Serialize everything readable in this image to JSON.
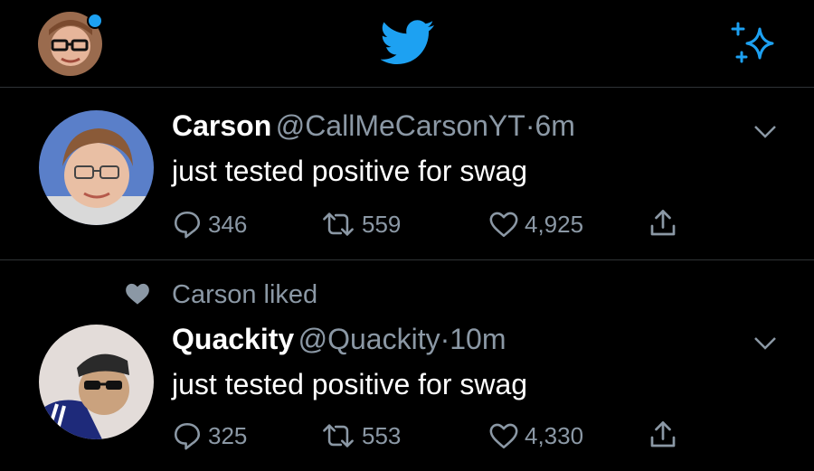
{
  "header": {
    "avatar_icon": "profile-avatar",
    "logo_icon": "twitter-bird-icon",
    "sparkle_icon": "sparkle-icon",
    "accent": "#1da1f2"
  },
  "tweets": [
    {
      "name": "Carson",
      "handle": "@CallMeCarsonYT",
      "sep": "·",
      "time": "6m",
      "text": "just tested positive for swag",
      "replies": "346",
      "retweets": "559",
      "likes": "4,925"
    },
    {
      "social_context": "Carson liked",
      "name": "Quackity",
      "handle": "@Quackity",
      "sep": "·",
      "time": "10m",
      "text": "just tested positive for swag",
      "replies": "325",
      "retweets": "553",
      "likes": "4,330"
    }
  ],
  "colors": {
    "background": "#000000",
    "secondary_text": "#8b98a5",
    "divider": "#2f3336"
  }
}
